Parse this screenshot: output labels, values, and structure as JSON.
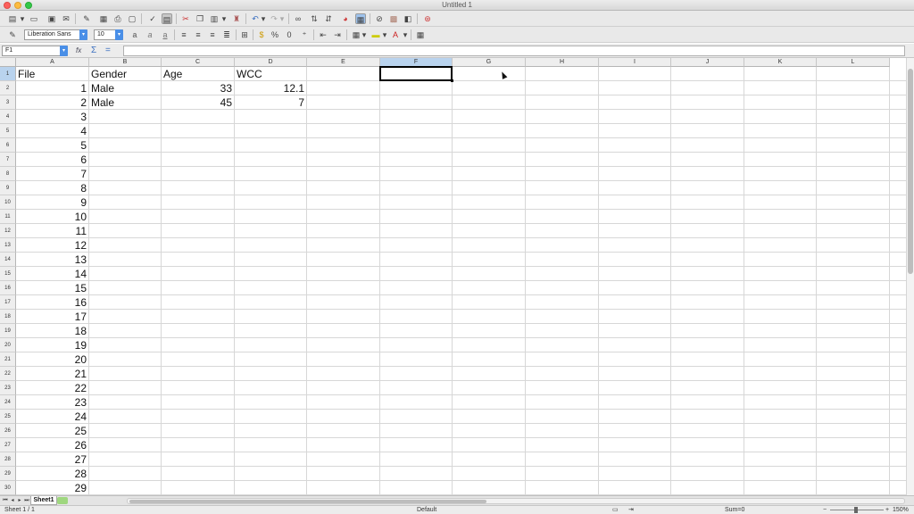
{
  "window": {
    "title": "Untitled 1"
  },
  "toolbar": {
    "font_name": "Liberation Sans",
    "font_size": "10"
  },
  "formula_bar": {
    "name_box": "F1",
    "function_wizard_label": "fx",
    "sum_label": "Σ",
    "formula_label": "=",
    "formula_value": ""
  },
  "sheet": {
    "columns": [
      "A",
      "B",
      "C",
      "D",
      "E",
      "F",
      "G",
      "H",
      "I",
      "J",
      "K",
      "L"
    ],
    "rows": [
      "1",
      "2",
      "3",
      "4",
      "5",
      "6",
      "7",
      "8",
      "9",
      "10",
      "11",
      "12",
      "13",
      "14",
      "15",
      "16",
      "17",
      "18",
      "19",
      "20",
      "21",
      "22",
      "23",
      "24",
      "25",
      "26",
      "27",
      "28",
      "29",
      "30"
    ],
    "header_cells": [
      "File",
      "Gender",
      "Age",
      "WCC"
    ],
    "data_rows": [
      {
        "file": "1",
        "gender": "Male",
        "age": "33",
        "wcc": "12.1"
      },
      {
        "file": "2",
        "gender": "Male",
        "age": "45",
        "wcc": "7"
      }
    ],
    "file_numbers": [
      "3",
      "4",
      "5",
      "6",
      "7",
      "8",
      "9",
      "10",
      "11",
      "12",
      "13",
      "14",
      "15",
      "16",
      "17",
      "18",
      "19",
      "20",
      "21",
      "22",
      "23",
      "24",
      "25",
      "26",
      "27",
      "28",
      "29"
    ],
    "selected_cell": "F1"
  },
  "tabs": {
    "sheet1": "Sheet1"
  },
  "status": {
    "sheet_count": "Sheet 1 / 1",
    "page_style": "Default",
    "sum": "Sum=0",
    "zoom": "150%"
  },
  "colors": {
    "selection_header": "#b9d3ee",
    "accent": "#4a8fe7"
  }
}
